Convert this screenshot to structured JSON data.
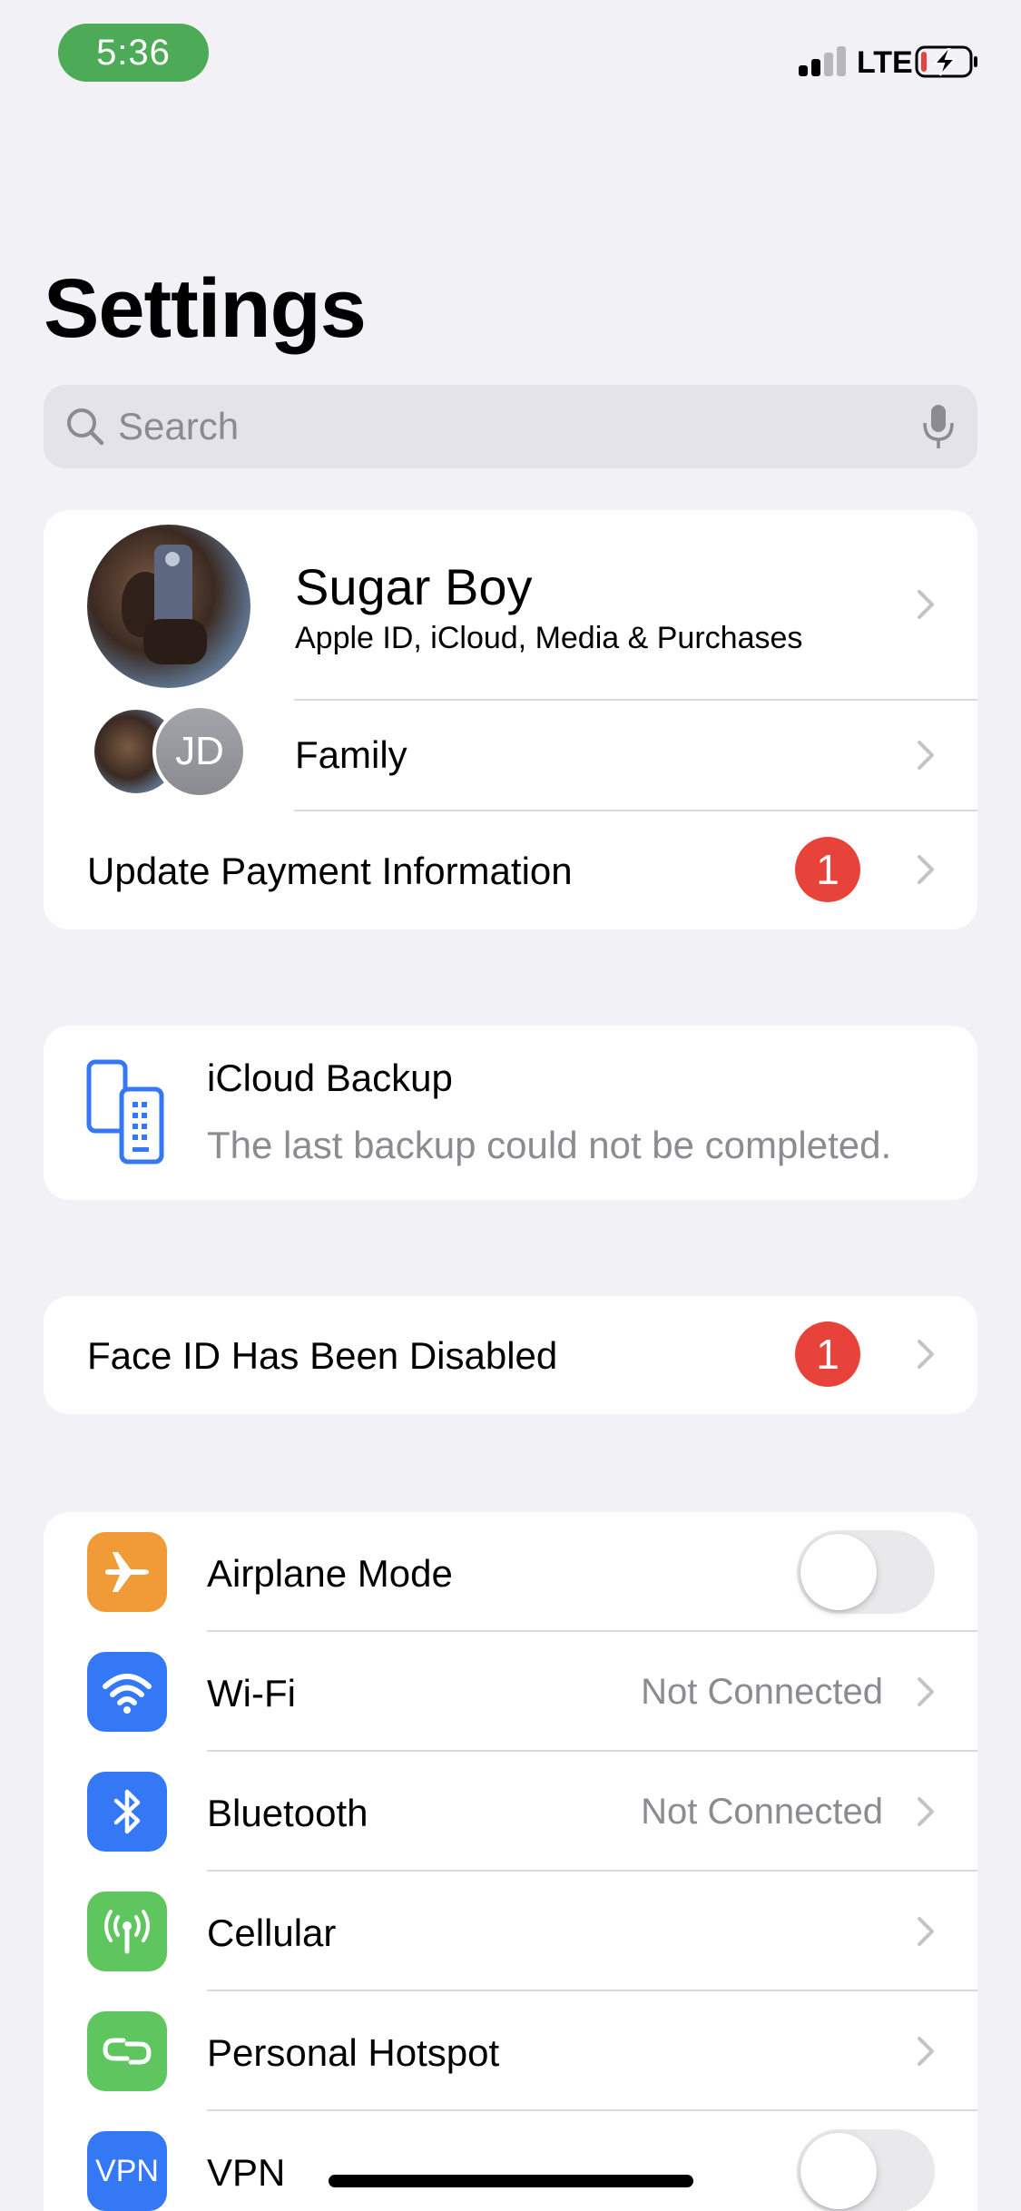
{
  "status_bar": {
    "time": "5:36",
    "network": "LTE",
    "battery_charging": true
  },
  "title": "Settings",
  "search": {
    "placeholder": "Search"
  },
  "account": {
    "name": "Sugar  Boy",
    "subtitle": "Apple ID, iCloud, Media & Purchases",
    "family_label": "Family",
    "family_initials": "JD",
    "payment_label": "Update Payment Information",
    "payment_badge": "1"
  },
  "backup": {
    "title": "iCloud Backup",
    "message": "The last backup could not be completed."
  },
  "faceid": {
    "label": "Face ID Has Been Disabled",
    "badge": "1"
  },
  "settings": [
    {
      "label": "Airplane Mode",
      "icon": "airplane-icon",
      "color": "#f19a38",
      "toggle": false
    },
    {
      "label": "Wi-Fi",
      "icon": "wifi-icon",
      "color": "#3478f6",
      "value": "Not Connected"
    },
    {
      "label": "Bluetooth",
      "icon": "bluetooth-icon",
      "color": "#3478f6",
      "value": "Not Connected"
    },
    {
      "label": "Cellular",
      "icon": "cellular-icon",
      "color": "#5fc65f"
    },
    {
      "label": "Personal Hotspot",
      "icon": "hotspot-icon",
      "color": "#5fc65f"
    },
    {
      "label": "VPN",
      "icon": "vpn-icon",
      "color": "#3478f6",
      "icon_text": "VPN",
      "toggle": false
    }
  ]
}
